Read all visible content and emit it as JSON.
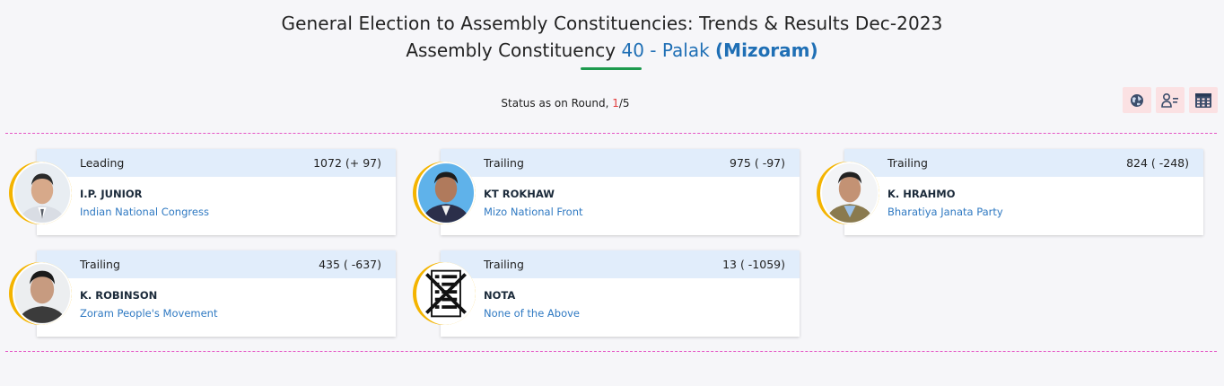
{
  "header": {
    "title_line1": "General Election to Assembly Constituencies: Trends & Results Dec-2023",
    "title_prefix": "Assembly Constituency",
    "constituency": "40 - Palak",
    "state": "(Mizoram)"
  },
  "status": {
    "prefix": "Status as on Round, ",
    "current_round": "1",
    "total_rounds": "/5"
  },
  "toolbar": {
    "buttons": [
      {
        "icon": "globe-icon"
      },
      {
        "icon": "candidate-list-icon"
      },
      {
        "icon": "table-grid-icon"
      }
    ]
  },
  "candidates": [
    {
      "status": "Leading",
      "votes": "1072 (+ 97)",
      "name": "I.P. JUNIOR",
      "party": "Indian National Congress"
    },
    {
      "status": "Trailing",
      "votes": "975 ( -97)",
      "name": "KT ROKHAW",
      "party": "Mizo National Front"
    },
    {
      "status": "Trailing",
      "votes": "824 ( -248)",
      "name": "K. HRAHMO",
      "party": "Bharatiya Janata Party"
    },
    {
      "status": "Trailing",
      "votes": "435 ( -637)",
      "name": "K. ROBINSON",
      "party": "Zoram People's Movement"
    },
    {
      "status": "Trailing",
      "votes": "13 ( -1059)",
      "name": "NOTA",
      "party": "None of the Above"
    }
  ],
  "colors": {
    "accent_blue": "#1f6fb5",
    "underline_green": "#1d9a4e",
    "round_red": "#e23b3b",
    "ring_gold": "#f4b400",
    "divider_pink": "#e556c5",
    "card_header_bg": "#e1edfb"
  }
}
